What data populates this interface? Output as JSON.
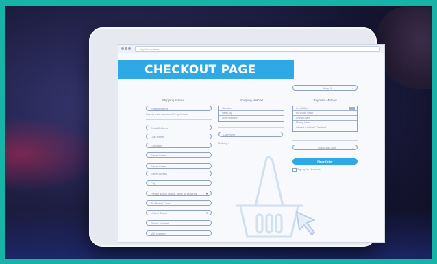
{
  "browser": {
    "url": "http://www.shop"
  },
  "banner": {
    "title": "CHECKOUT PAGE"
  },
  "shipping_address": {
    "title": "Shipping Adress",
    "email_placeholder": "Email Address",
    "have_account_text": "Already have an account? Log In Here",
    "fields": [
      "Email Address",
      "Last Name",
      "Company",
      "Street Adress",
      "Street Adress",
      "Street Adress",
      "City"
    ],
    "region_placeholder": "Please select region, state or province",
    "zip_placeholder": "Zip Postal Code",
    "country_value": "United States",
    "phone_placeholder": "Phone Number",
    "vat_placeholder": "VAT number"
  },
  "shipping_method": {
    "title": "Shipping Method",
    "options": [
      "Standard",
      "Next Day",
      "Free Shipping"
    ],
    "comment_placeholder": "Comment",
    "delivery_label": "Delivery ▾"
  },
  "payment_method": {
    "language_value": "Jump 1",
    "title": "Payment Method",
    "options": [
      "Credit Card",
      "Purchase Order",
      "Check Order",
      "Money Order",
      "Interest Ir Waived Checkout"
    ],
    "discount_placeholder": "Discount Code",
    "place_order_label": "Place Order",
    "newsletter_label": "Sign up for Newsletter"
  }
}
